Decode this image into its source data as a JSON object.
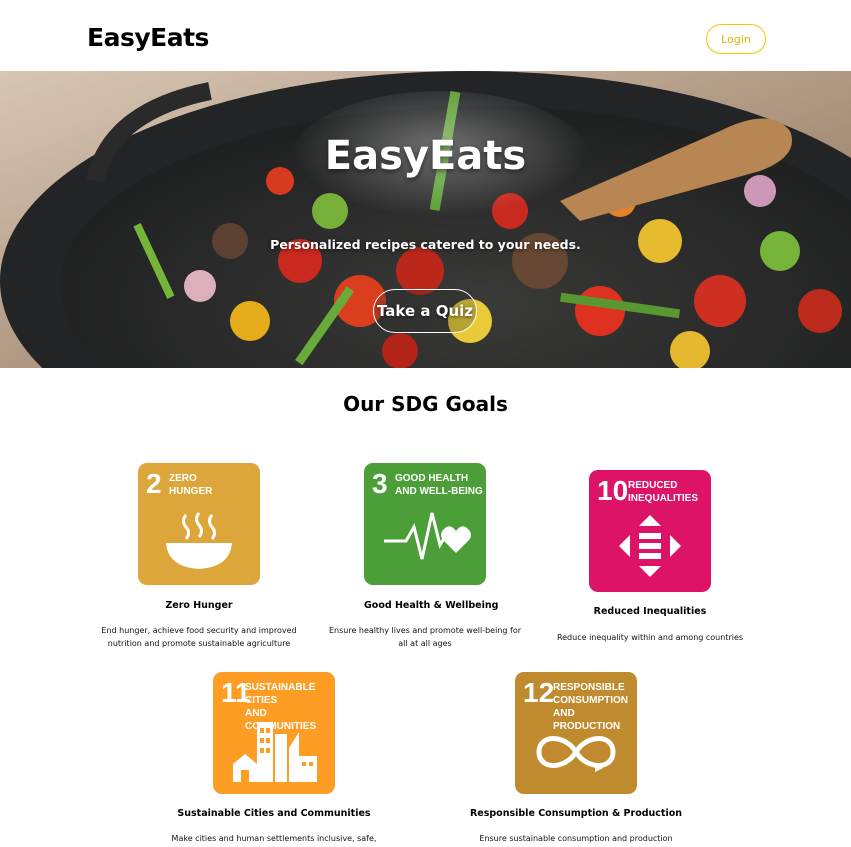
{
  "header": {
    "brand": "EasyEats",
    "login_label": "Login"
  },
  "hero": {
    "title": "EasyEats",
    "subtitle": "Personalized recipes catered to your needs.",
    "cta_label": "Take a Quiz"
  },
  "sdg_section": {
    "title": "Our SDG Goals",
    "goals": [
      {
        "number": "2",
        "tile_title": "ZERO\nHUNGER",
        "color": "#dda63a",
        "icon": "bowl-icon",
        "name": "Zero Hunger",
        "description": "End hunger, achieve food security and improved nutrition and promote sustainable agriculture"
      },
      {
        "number": "3",
        "tile_title": "GOOD HEALTH\nAND WELL-BEING",
        "color": "#4c9f38",
        "icon": "heartbeat-icon",
        "name": "Good Health & Wellbeing",
        "description": "Ensure healthy lives and promote well-being for all at all ages"
      },
      {
        "number": "10",
        "tile_title": "REDUCED\nINEQUALITIES",
        "color": "#dd1367",
        "icon": "equality-arrows-icon",
        "name": "Reduced Inequalities",
        "description": "Reduce inequality within and among countries"
      },
      {
        "number": "11",
        "tile_title": "SUSTAINABLE CITIES\nAND COMMUNITIES",
        "color": "#fd9d24",
        "icon": "city-buildings-icon",
        "name": "Sustainable Cities and Communities",
        "description": "Make cities and human settlements inclusive, safe,"
      },
      {
        "number": "12",
        "tile_title": "RESPONSIBLE\nCONSUMPTION\nAND PRODUCTION",
        "color": "#bf8b2e",
        "icon": "infinity-loop-icon",
        "name": "Responsible Consumption & Production",
        "description": "Ensure sustainable consumption and production"
      }
    ]
  }
}
